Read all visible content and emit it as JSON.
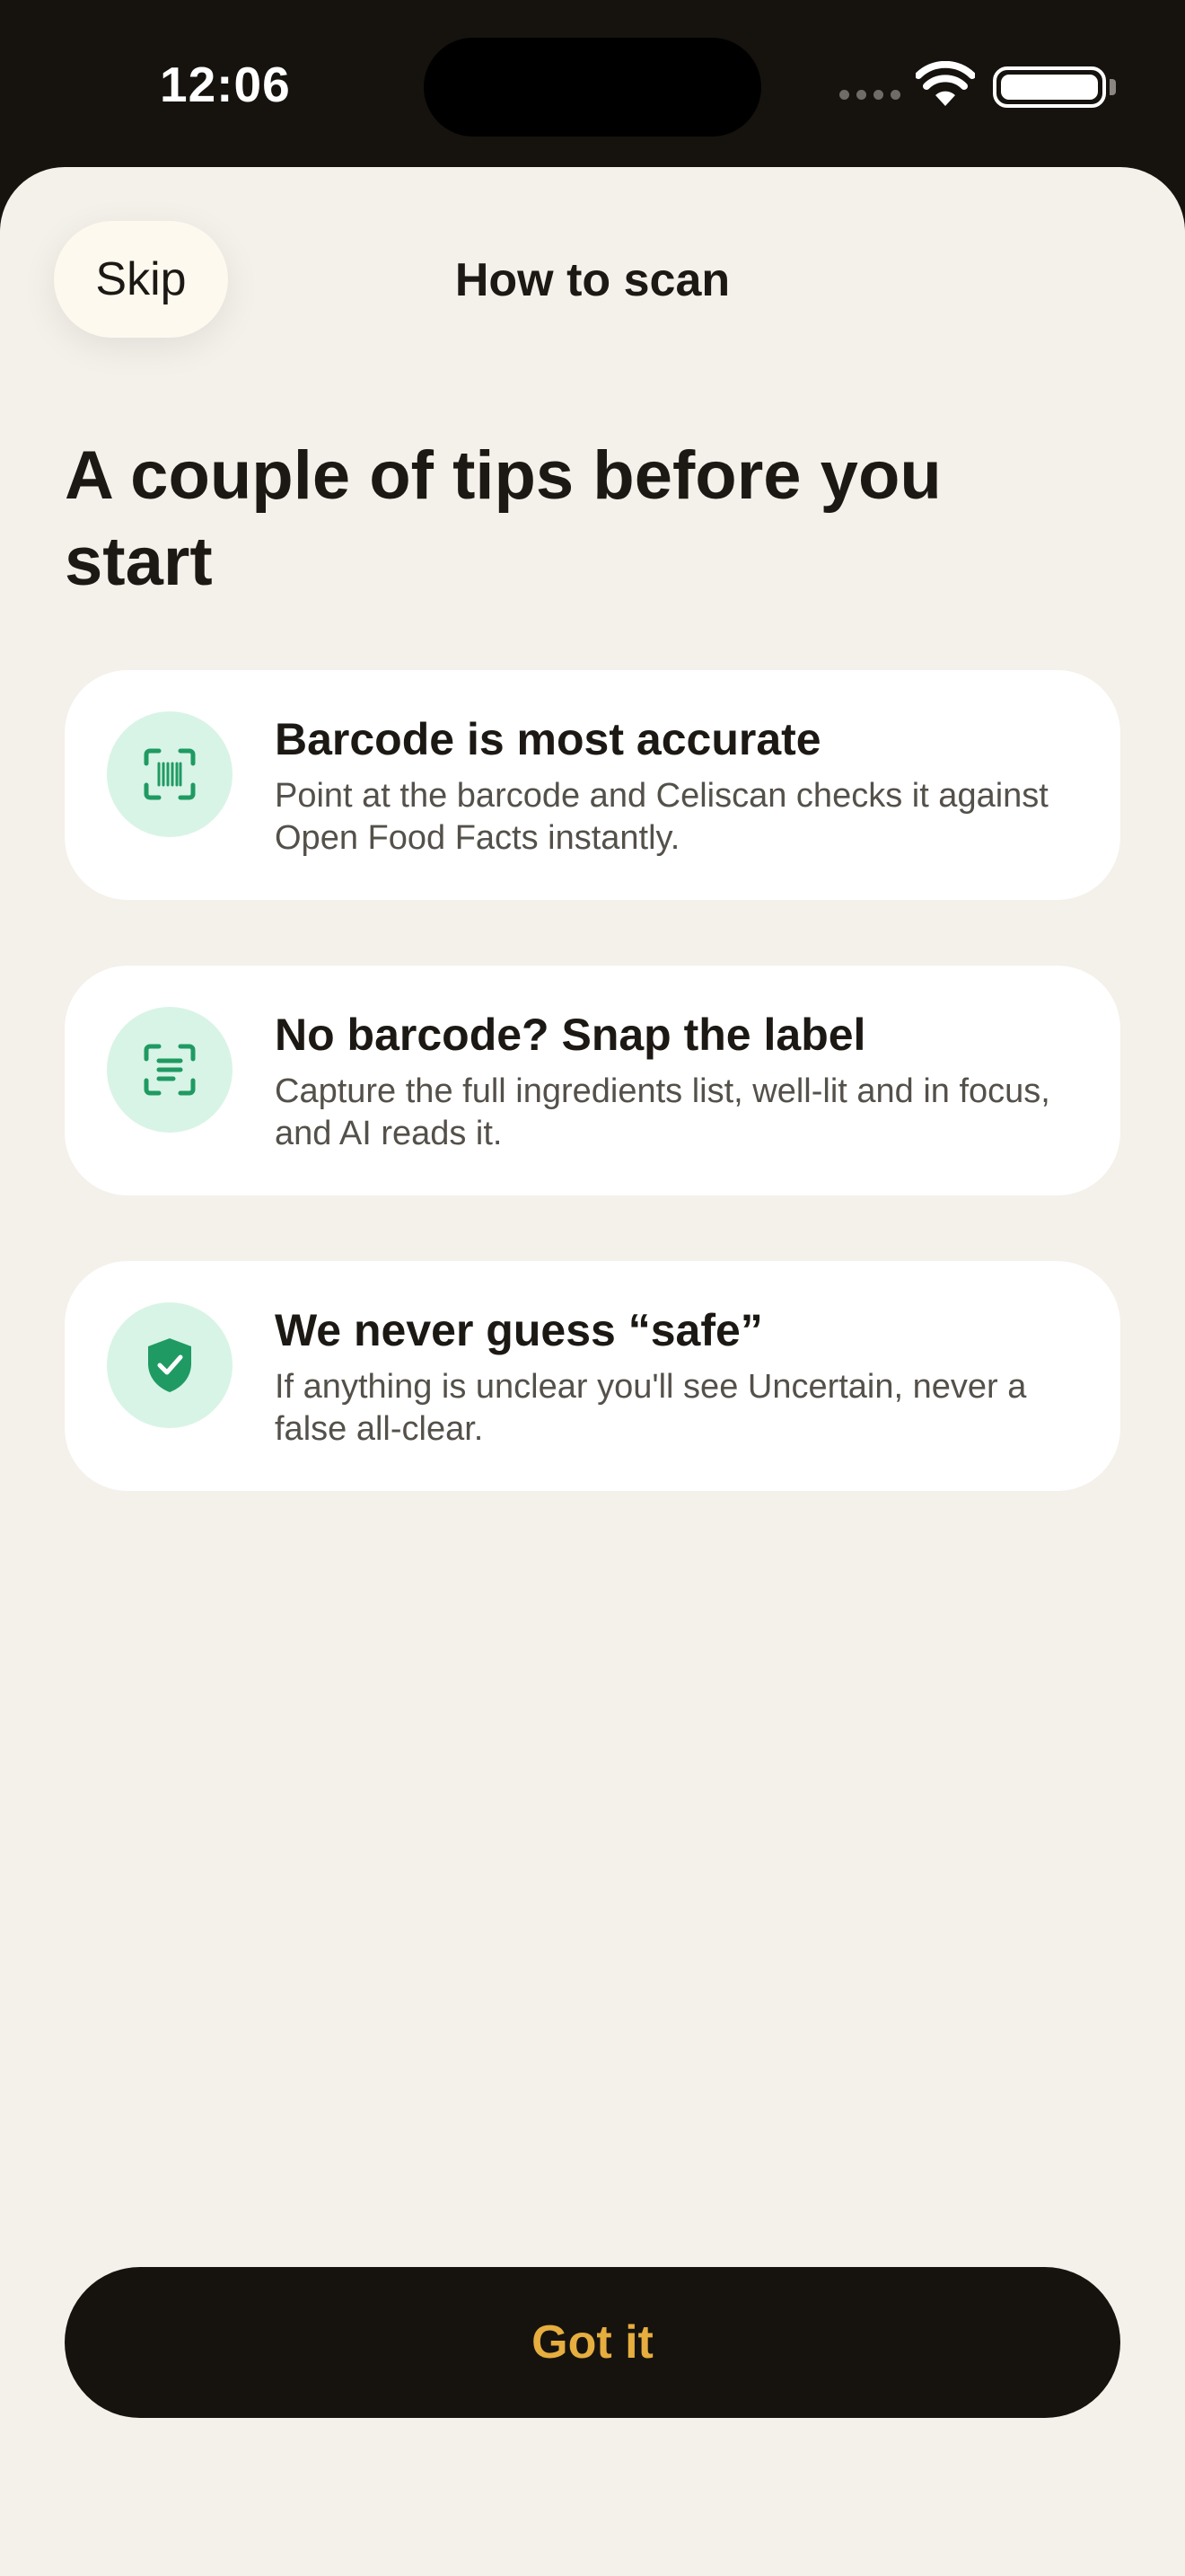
{
  "status_bar": {
    "time": "12:06"
  },
  "nav": {
    "skip_label": "Skip",
    "title": "How to scan"
  },
  "headline": "A couple of tips before you start",
  "tips": [
    {
      "icon": "barcode-scan-icon",
      "title": "Barcode is most accurate",
      "description": "Point at the barcode and Celiscan checks it against Open Food Facts instantly."
    },
    {
      "icon": "label-scan-icon",
      "title": "No barcode? Snap the label",
      "description": "Capture the full ingredients list, well-lit and in focus, and AI reads it."
    },
    {
      "icon": "shield-check-icon",
      "title": "We never guess “safe”",
      "description": "If anything is unclear you'll see Uncertain, never a false all-clear."
    }
  ],
  "primary_button": {
    "label": "Got it"
  },
  "colors": {
    "background": "#f4f0ea",
    "dark": "#16130f",
    "accent_gold": "#e6ad3f",
    "icon_green": "#1f9a63",
    "icon_bg": "#d8f4e6"
  }
}
